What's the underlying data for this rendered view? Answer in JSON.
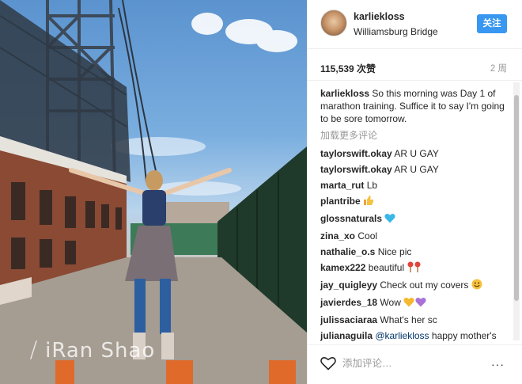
{
  "post": {
    "username": "karliekloss",
    "location": "Williamsburg Bridge",
    "follow_label": "关注",
    "likes": "115,539 次赞",
    "time": "2 周",
    "caption_user": "karliekloss",
    "caption_text": "So this morning was Day 1 of marathon training. Suffice it to say I'm going to be sore tomorrow.",
    "load_more": "加载更多评论",
    "add_comment_placeholder": "添加评论…",
    "more_label": "···"
  },
  "watermark": "⧸ iRan Shao",
  "comments": [
    {
      "user": "taylorswift.okay",
      "text": "AR U GAY",
      "emoji": ""
    },
    {
      "user": "taylorswift.okay",
      "text": "AR U GAY",
      "emoji": ""
    },
    {
      "user": "marta_rut",
      "text": "Lb",
      "emoji": ""
    },
    {
      "user": "plantribe",
      "text": "",
      "emoji": "thumbs-up-icon"
    },
    {
      "user": "glossnaturals",
      "text": "",
      "emoji": "blue-heart-icon"
    },
    {
      "user": "zina_xo",
      "text": "Cool",
      "emoji": ""
    },
    {
      "user": "nathalie_o.s",
      "text": "Nice pic",
      "emoji": ""
    },
    {
      "user": "kamex222",
      "text": "beautiful",
      "emoji": "lollipop-icon"
    },
    {
      "user": "jay_quigleyy",
      "text": "Check out my covers",
      "emoji": "smile-icon"
    },
    {
      "user": "javierdes_18",
      "text": "Wow",
      "emoji": "yellow-purple-hearts-icon"
    },
    {
      "user": "julissaciaraa",
      "text": "What's her sc",
      "emoji": ""
    },
    {
      "user": "julianaguila",
      "mention": "@karliekloss",
      "text": "happy mother's day Karlie",
      "emoji": ""
    }
  ],
  "colors": {
    "follow": "#3897f0",
    "text": "#262626",
    "muted": "#999999",
    "mention": "#003569"
  }
}
